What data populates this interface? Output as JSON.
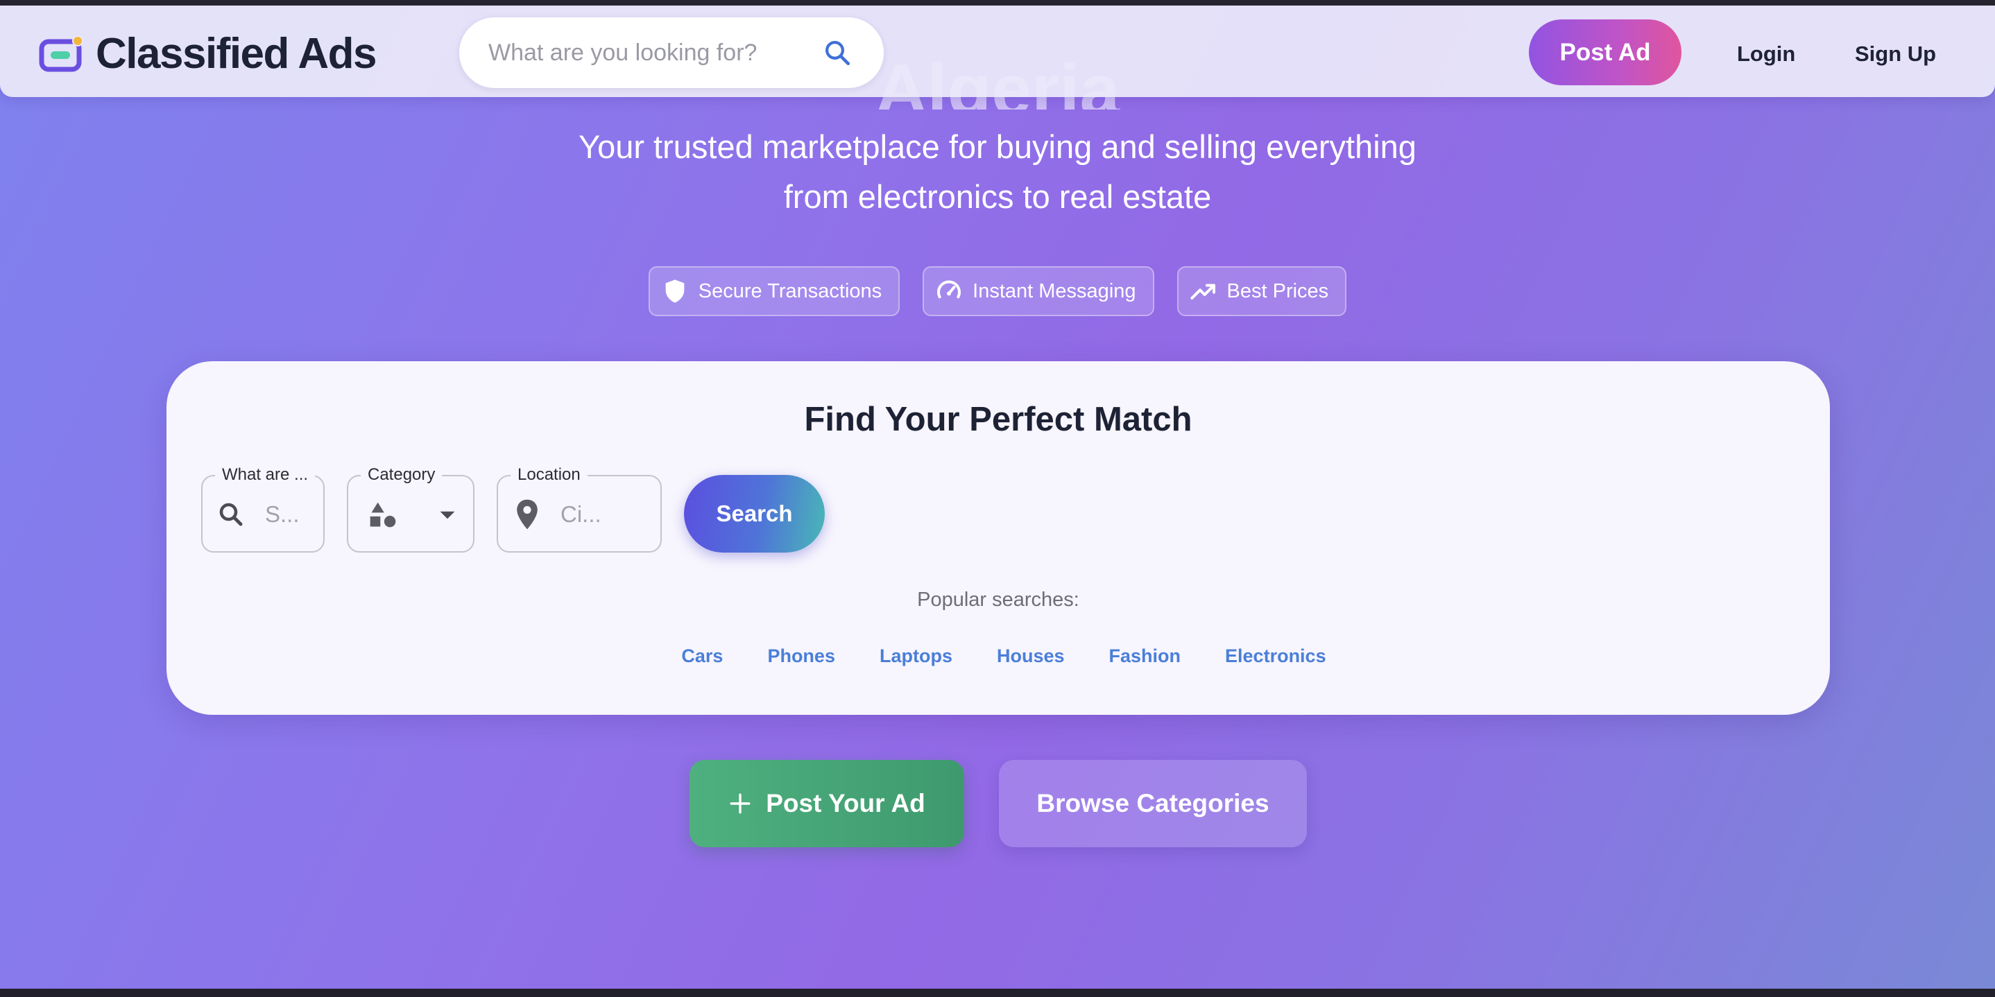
{
  "nav": {
    "brand": "Classified Ads",
    "search_placeholder": "What are you looking for?",
    "post_ad": "Post Ad",
    "login": "Login",
    "signup": "Sign Up"
  },
  "hero": {
    "ghost_title": "Algeria",
    "subtitle_line1": "Your trusted marketplace for buying and selling everything",
    "subtitle_line2": "from electronics to real estate",
    "badges": [
      {
        "label": "Secure Transactions",
        "icon": "shield-icon"
      },
      {
        "label": "Instant Messaging",
        "icon": "speedometer-icon"
      },
      {
        "label": "Best Prices",
        "icon": "trending-up-icon"
      }
    ]
  },
  "search_card": {
    "title": "Find Your Perfect Match",
    "what_label": "What are ...",
    "what_placeholder": "S...",
    "category_label": "Category",
    "location_label": "Location",
    "location_placeholder": "Ci...",
    "search_button": "Search",
    "popular_label": "Popular searches:",
    "popular_tags": [
      "Cars",
      "Phones",
      "Laptops",
      "Houses",
      "Fashion",
      "Electronics"
    ]
  },
  "cta": {
    "post_your_ad": "Post Your Ad",
    "browse_categories": "Browse Categories"
  },
  "colors": {
    "accent_purple": "#9254e2",
    "accent_pink": "#e0559e",
    "link_blue": "#4a7fd8",
    "cta_green": "#4fb07f"
  }
}
